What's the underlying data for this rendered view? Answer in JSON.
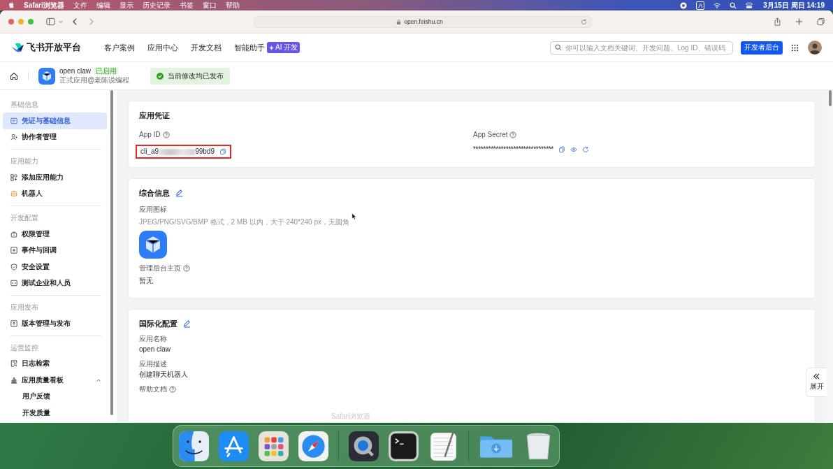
{
  "menubar": {
    "app": "Safari浏览器",
    "menus": [
      "文件",
      "编辑",
      "显示",
      "历史记录",
      "书签",
      "窗口",
      "帮助"
    ],
    "input_source": "A",
    "clock": "3月15日 周日  14:19"
  },
  "browser": {
    "url": "open.feishu.cn"
  },
  "site_header": {
    "logo": "飞书开放平台",
    "nav": [
      {
        "label": "客户案例"
      },
      {
        "label": "应用中心"
      },
      {
        "label": "开发文档"
      },
      {
        "label": "智能助手",
        "badge": "AI 开发"
      }
    ],
    "search": {
      "placeholder": "你可以输入文档关键词、开发问题、Log ID、错误码"
    },
    "console_button": "开发者后台"
  },
  "app_bar": {
    "name": "open claw",
    "status": "已启用",
    "subtitle": "正式应用@老陈说编程",
    "notice": "当前修改均已发布"
  },
  "sidebar": {
    "sections": [
      {
        "title": "基础信息",
        "items": [
          {
            "label": "凭证与基础信息",
            "selected": true
          },
          {
            "label": "协作者管理",
            "selected": false
          }
        ]
      },
      {
        "title": "应用能力",
        "items": [
          {
            "label": "添加应用能力",
            "selected": false
          },
          {
            "label": "机器人",
            "selected": false
          }
        ]
      },
      {
        "title": "开发配置",
        "items": [
          {
            "label": "权限管理",
            "selected": false
          },
          {
            "label": "事件与回调",
            "selected": false
          },
          {
            "label": "安全设置",
            "selected": false
          },
          {
            "label": "测试企业和人员",
            "selected": false
          }
        ]
      },
      {
        "title": "应用发布",
        "items": [
          {
            "label": "版本管理与发布",
            "selected": false
          }
        ]
      },
      {
        "title": "运营监控",
        "items": [
          {
            "label": "日志检索",
            "selected": false
          },
          {
            "label": "应用质量看板",
            "selected": false,
            "expanded": true,
            "children": [
              {
                "label": "用户反馈",
                "selected": false
              },
              {
                "label": "开发质量",
                "selected": false
              }
            ]
          }
        ]
      }
    ]
  },
  "credentials": {
    "title": "应用凭证",
    "app_id": {
      "label": "App ID",
      "prefix": "cli_a9",
      "suffix": "99bd9",
      "highlighted": true
    },
    "app_secret": {
      "label": "App Secret",
      "value": "********************************"
    }
  },
  "general": {
    "title": "综合信息",
    "icon_label": "应用图标",
    "icon_hint": "JPEG/PNG/SVG/BMP 格式，2 MB 以内，大于 240*240 px，无圆角",
    "homepage_label": "管理后台主页",
    "homepage_value": "暂无"
  },
  "i18n": {
    "title": "国际化配置",
    "fields": [
      {
        "label": "应用名称",
        "value": "open claw",
        "help": false
      },
      {
        "label": "应用描述",
        "value": "创建聊天机器人",
        "help": false
      },
      {
        "label": "帮助文档",
        "help": true
      }
    ]
  },
  "expand_button": "展开",
  "dock": {
    "tooltip": "Safari浏览器"
  }
}
